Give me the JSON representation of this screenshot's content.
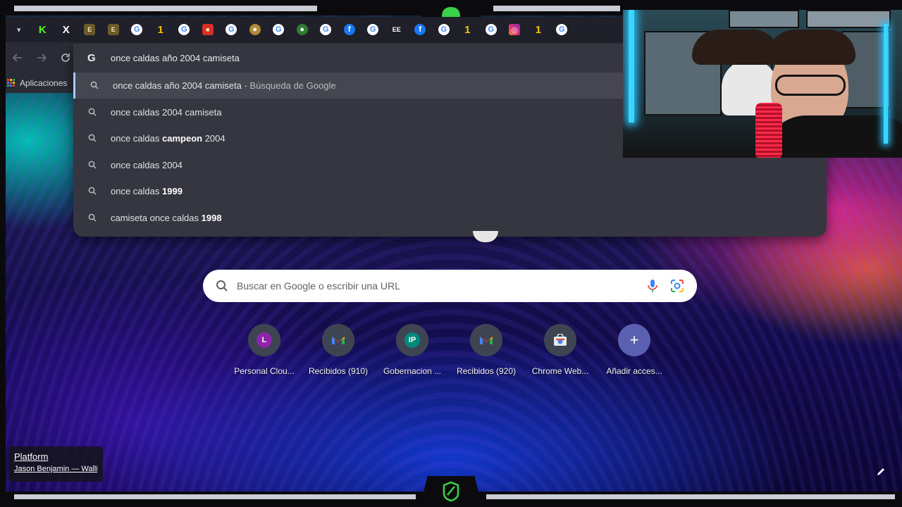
{
  "tabs": [
    {
      "icon": "kick-icon",
      "glyph": "K",
      "color": "#53fc18"
    },
    {
      "icon": "x-icon",
      "glyph": "X",
      "color": "#000000"
    },
    {
      "icon": "site-icon",
      "glyph": "E",
      "color": "#6b5a2a"
    },
    {
      "icon": "site-icon",
      "glyph": "E",
      "color": "#6b5a2a"
    },
    {
      "icon": "google-icon",
      "glyph": "G",
      "color": "#ffffff"
    },
    {
      "icon": "one-icon",
      "glyph": "1",
      "color": "#f5c400"
    },
    {
      "icon": "google-icon",
      "glyph": "G",
      "color": "#ffffff"
    },
    {
      "icon": "site-icon",
      "glyph": "■",
      "color": "#d93025"
    },
    {
      "icon": "google-icon",
      "glyph": "G",
      "color": "#ffffff"
    },
    {
      "icon": "crest-icon",
      "glyph": "●",
      "color": "#b38a3a"
    },
    {
      "icon": "google-icon",
      "glyph": "G",
      "color": "#ffffff"
    },
    {
      "icon": "crest-icon",
      "glyph": "●",
      "color": "#2e7d32"
    },
    {
      "icon": "google-icon",
      "glyph": "G",
      "color": "#ffffff"
    },
    {
      "icon": "facebook-icon",
      "glyph": "f",
      "color": "#1877f2"
    },
    {
      "icon": "google-icon",
      "glyph": "G",
      "color": "#ffffff"
    },
    {
      "icon": "site-icon",
      "glyph": "EE",
      "color": "#ffffff"
    },
    {
      "icon": "facebook-icon",
      "glyph": "f",
      "color": "#1877f2"
    },
    {
      "icon": "google-icon",
      "glyph": "G",
      "color": "#ffffff"
    },
    {
      "icon": "one-icon",
      "glyph": "1",
      "color": "#f5c400"
    },
    {
      "icon": "google-icon",
      "glyph": "G",
      "color": "#ffffff"
    },
    {
      "icon": "instagram-icon",
      "glyph": "◎",
      "color": "#e1306c"
    },
    {
      "icon": "one-icon",
      "glyph": "1",
      "color": "#f5c400"
    },
    {
      "icon": "google-icon",
      "glyph": "G",
      "color": "#ffffff"
    }
  ],
  "bookmarks": {
    "apps_label": "Aplicaciones"
  },
  "omnibox": {
    "query": "once caldas año 2004 camiseta",
    "suggestions": [
      {
        "parts": [
          {
            "t": "once caldas año 2004 camiseta",
            "b": false
          }
        ],
        "suffix": " - Búsqueda de Google"
      },
      {
        "parts": [
          {
            "t": "once caldas 2004 camiseta",
            "b": false
          }
        ],
        "suffix": ""
      },
      {
        "parts": [
          {
            "t": "once caldas ",
            "b": false
          },
          {
            "t": "campeon",
            "b": true
          },
          {
            "t": " 2004",
            "b": false
          }
        ],
        "suffix": ""
      },
      {
        "parts": [
          {
            "t": "once caldas 2004",
            "b": false
          }
        ],
        "suffix": ""
      },
      {
        "parts": [
          {
            "t": "once caldas ",
            "b": false
          },
          {
            "t": "1999",
            "b": true
          }
        ],
        "suffix": ""
      },
      {
        "parts": [
          {
            "t": "camiseta once caldas ",
            "b": false
          },
          {
            "t": "1998",
            "b": true
          }
        ],
        "suffix": ""
      }
    ]
  },
  "search": {
    "placeholder": "Buscar en Google o escribir una URL"
  },
  "shortcuts": [
    {
      "name": "Personal Clou...",
      "letter": "L",
      "color": "#8e24aa",
      "icon": "letter-l-icon"
    },
    {
      "name": "Recibidos (910)",
      "letter": "M",
      "color": "gmail",
      "icon": "gmail-icon"
    },
    {
      "name": "Gobernacion ...",
      "letter": "IP",
      "color": "#00897b",
      "icon": "letter-ip-icon"
    },
    {
      "name": "Recibidos (920)",
      "letter": "M",
      "color": "gmail",
      "icon": "gmail-icon"
    },
    {
      "name": "Chrome Web...",
      "letter": "",
      "color": "webstore",
      "icon": "chrome-web-store-icon"
    },
    {
      "name": "Añadir acces...",
      "letter": "+",
      "color": "#5b5fb0",
      "icon": "plus-icon"
    }
  ],
  "overlay": {
    "platform_title": "Platform",
    "platform_sub": "Jason Benjamin — Walli"
  },
  "colors": {
    "omnibox_bg": "#35363f",
    "selected_row": "#45464f",
    "accent": "#a8c7fa"
  }
}
